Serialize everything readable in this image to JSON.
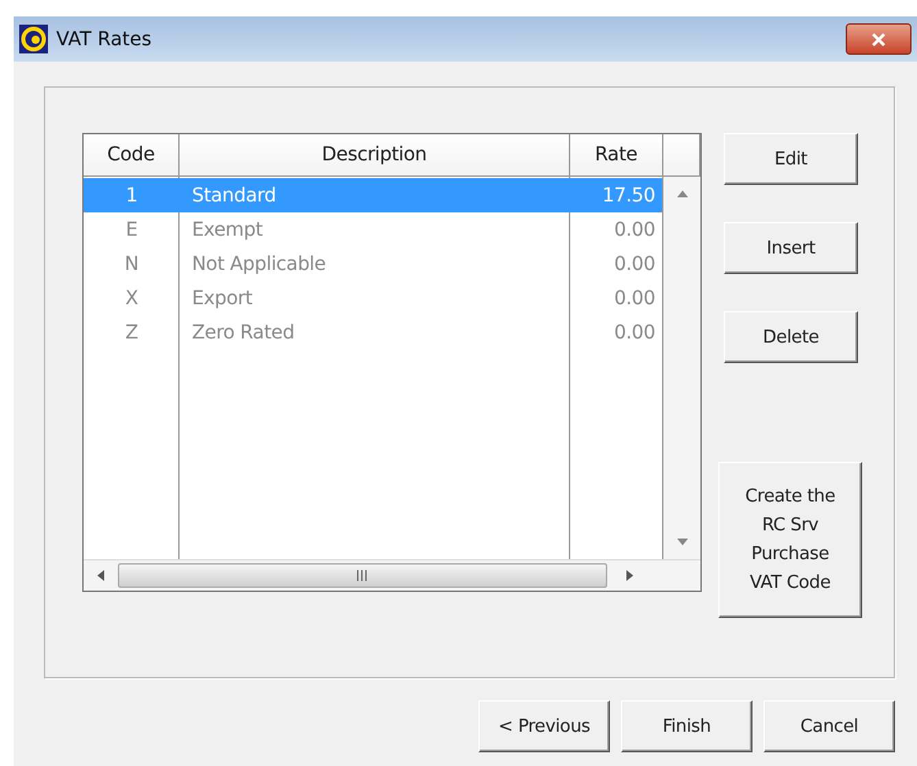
{
  "window": {
    "title": "VAT Rates"
  },
  "table": {
    "columns": [
      "Code",
      "Description",
      "Rate"
    ],
    "rows": [
      {
        "code": "1",
        "description": "Standard",
        "rate": "17.50",
        "selected": true
      },
      {
        "code": "E",
        "description": "Exempt",
        "rate": "0.00",
        "selected": false
      },
      {
        "code": "N",
        "description": "Not Applicable",
        "rate": "0.00",
        "selected": false
      },
      {
        "code": "X",
        "description": "Export",
        "rate": "0.00",
        "selected": false
      },
      {
        "code": "Z",
        "description": "Zero Rated",
        "rate": "0.00",
        "selected": false
      }
    ]
  },
  "side_buttons": [
    {
      "label": "Edit",
      "kind": "small"
    },
    {
      "label": "Insert",
      "kind": "small"
    },
    {
      "label": "Delete",
      "kind": "small"
    },
    {
      "label": "Create the RC Srv Purchase VAT Code",
      "kind": "large"
    }
  ],
  "footer_buttons": [
    "< Previous",
    "Finish",
    "Cancel"
  ]
}
